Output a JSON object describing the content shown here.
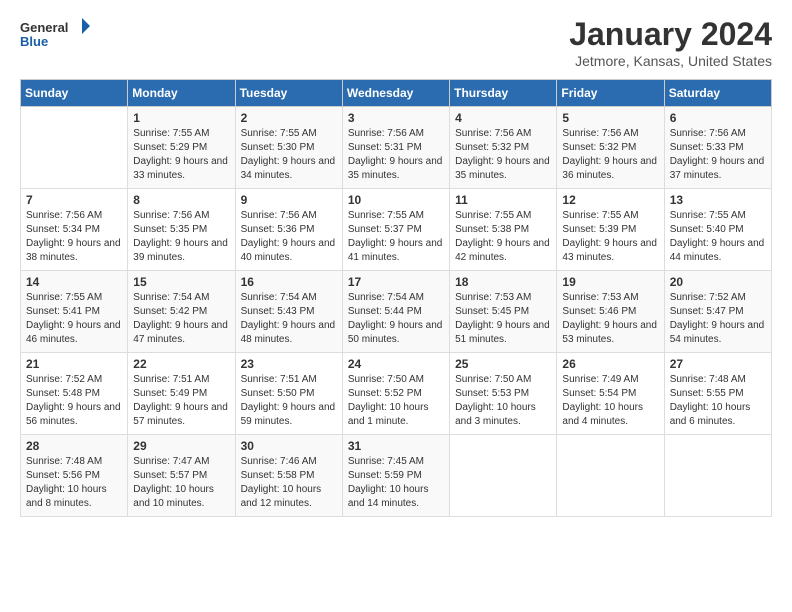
{
  "logo": {
    "line1": "General",
    "line2": "Blue"
  },
  "title": "January 2024",
  "location": "Jetmore, Kansas, United States",
  "weekdays": [
    "Sunday",
    "Monday",
    "Tuesday",
    "Wednesday",
    "Thursday",
    "Friday",
    "Saturday"
  ],
  "weeks": [
    [
      {
        "day": "",
        "sunrise": "",
        "sunset": "",
        "daylight": ""
      },
      {
        "day": "1",
        "sunrise": "Sunrise: 7:55 AM",
        "sunset": "Sunset: 5:29 PM",
        "daylight": "Daylight: 9 hours and 33 minutes."
      },
      {
        "day": "2",
        "sunrise": "Sunrise: 7:55 AM",
        "sunset": "Sunset: 5:30 PM",
        "daylight": "Daylight: 9 hours and 34 minutes."
      },
      {
        "day": "3",
        "sunrise": "Sunrise: 7:56 AM",
        "sunset": "Sunset: 5:31 PM",
        "daylight": "Daylight: 9 hours and 35 minutes."
      },
      {
        "day": "4",
        "sunrise": "Sunrise: 7:56 AM",
        "sunset": "Sunset: 5:32 PM",
        "daylight": "Daylight: 9 hours and 35 minutes."
      },
      {
        "day": "5",
        "sunrise": "Sunrise: 7:56 AM",
        "sunset": "Sunset: 5:32 PM",
        "daylight": "Daylight: 9 hours and 36 minutes."
      },
      {
        "day": "6",
        "sunrise": "Sunrise: 7:56 AM",
        "sunset": "Sunset: 5:33 PM",
        "daylight": "Daylight: 9 hours and 37 minutes."
      }
    ],
    [
      {
        "day": "7",
        "sunrise": "Sunrise: 7:56 AM",
        "sunset": "Sunset: 5:34 PM",
        "daylight": "Daylight: 9 hours and 38 minutes."
      },
      {
        "day": "8",
        "sunrise": "Sunrise: 7:56 AM",
        "sunset": "Sunset: 5:35 PM",
        "daylight": "Daylight: 9 hours and 39 minutes."
      },
      {
        "day": "9",
        "sunrise": "Sunrise: 7:56 AM",
        "sunset": "Sunset: 5:36 PM",
        "daylight": "Daylight: 9 hours and 40 minutes."
      },
      {
        "day": "10",
        "sunrise": "Sunrise: 7:55 AM",
        "sunset": "Sunset: 5:37 PM",
        "daylight": "Daylight: 9 hours and 41 minutes."
      },
      {
        "day": "11",
        "sunrise": "Sunrise: 7:55 AM",
        "sunset": "Sunset: 5:38 PM",
        "daylight": "Daylight: 9 hours and 42 minutes."
      },
      {
        "day": "12",
        "sunrise": "Sunrise: 7:55 AM",
        "sunset": "Sunset: 5:39 PM",
        "daylight": "Daylight: 9 hours and 43 minutes."
      },
      {
        "day": "13",
        "sunrise": "Sunrise: 7:55 AM",
        "sunset": "Sunset: 5:40 PM",
        "daylight": "Daylight: 9 hours and 44 minutes."
      }
    ],
    [
      {
        "day": "14",
        "sunrise": "Sunrise: 7:55 AM",
        "sunset": "Sunset: 5:41 PM",
        "daylight": "Daylight: 9 hours and 46 minutes."
      },
      {
        "day": "15",
        "sunrise": "Sunrise: 7:54 AM",
        "sunset": "Sunset: 5:42 PM",
        "daylight": "Daylight: 9 hours and 47 minutes."
      },
      {
        "day": "16",
        "sunrise": "Sunrise: 7:54 AM",
        "sunset": "Sunset: 5:43 PM",
        "daylight": "Daylight: 9 hours and 48 minutes."
      },
      {
        "day": "17",
        "sunrise": "Sunrise: 7:54 AM",
        "sunset": "Sunset: 5:44 PM",
        "daylight": "Daylight: 9 hours and 50 minutes."
      },
      {
        "day": "18",
        "sunrise": "Sunrise: 7:53 AM",
        "sunset": "Sunset: 5:45 PM",
        "daylight": "Daylight: 9 hours and 51 minutes."
      },
      {
        "day": "19",
        "sunrise": "Sunrise: 7:53 AM",
        "sunset": "Sunset: 5:46 PM",
        "daylight": "Daylight: 9 hours and 53 minutes."
      },
      {
        "day": "20",
        "sunrise": "Sunrise: 7:52 AM",
        "sunset": "Sunset: 5:47 PM",
        "daylight": "Daylight: 9 hours and 54 minutes."
      }
    ],
    [
      {
        "day": "21",
        "sunrise": "Sunrise: 7:52 AM",
        "sunset": "Sunset: 5:48 PM",
        "daylight": "Daylight: 9 hours and 56 minutes."
      },
      {
        "day": "22",
        "sunrise": "Sunrise: 7:51 AM",
        "sunset": "Sunset: 5:49 PM",
        "daylight": "Daylight: 9 hours and 57 minutes."
      },
      {
        "day": "23",
        "sunrise": "Sunrise: 7:51 AM",
        "sunset": "Sunset: 5:50 PM",
        "daylight": "Daylight: 9 hours and 59 minutes."
      },
      {
        "day": "24",
        "sunrise": "Sunrise: 7:50 AM",
        "sunset": "Sunset: 5:52 PM",
        "daylight": "Daylight: 10 hours and 1 minute."
      },
      {
        "day": "25",
        "sunrise": "Sunrise: 7:50 AM",
        "sunset": "Sunset: 5:53 PM",
        "daylight": "Daylight: 10 hours and 3 minutes."
      },
      {
        "day": "26",
        "sunrise": "Sunrise: 7:49 AM",
        "sunset": "Sunset: 5:54 PM",
        "daylight": "Daylight: 10 hours and 4 minutes."
      },
      {
        "day": "27",
        "sunrise": "Sunrise: 7:48 AM",
        "sunset": "Sunset: 5:55 PM",
        "daylight": "Daylight: 10 hours and 6 minutes."
      }
    ],
    [
      {
        "day": "28",
        "sunrise": "Sunrise: 7:48 AM",
        "sunset": "Sunset: 5:56 PM",
        "daylight": "Daylight: 10 hours and 8 minutes."
      },
      {
        "day": "29",
        "sunrise": "Sunrise: 7:47 AM",
        "sunset": "Sunset: 5:57 PM",
        "daylight": "Daylight: 10 hours and 10 minutes."
      },
      {
        "day": "30",
        "sunrise": "Sunrise: 7:46 AM",
        "sunset": "Sunset: 5:58 PM",
        "daylight": "Daylight: 10 hours and 12 minutes."
      },
      {
        "day": "31",
        "sunrise": "Sunrise: 7:45 AM",
        "sunset": "Sunset: 5:59 PM",
        "daylight": "Daylight: 10 hours and 14 minutes."
      },
      {
        "day": "",
        "sunrise": "",
        "sunset": "",
        "daylight": ""
      },
      {
        "day": "",
        "sunrise": "",
        "sunset": "",
        "daylight": ""
      },
      {
        "day": "",
        "sunrise": "",
        "sunset": "",
        "daylight": ""
      }
    ]
  ]
}
